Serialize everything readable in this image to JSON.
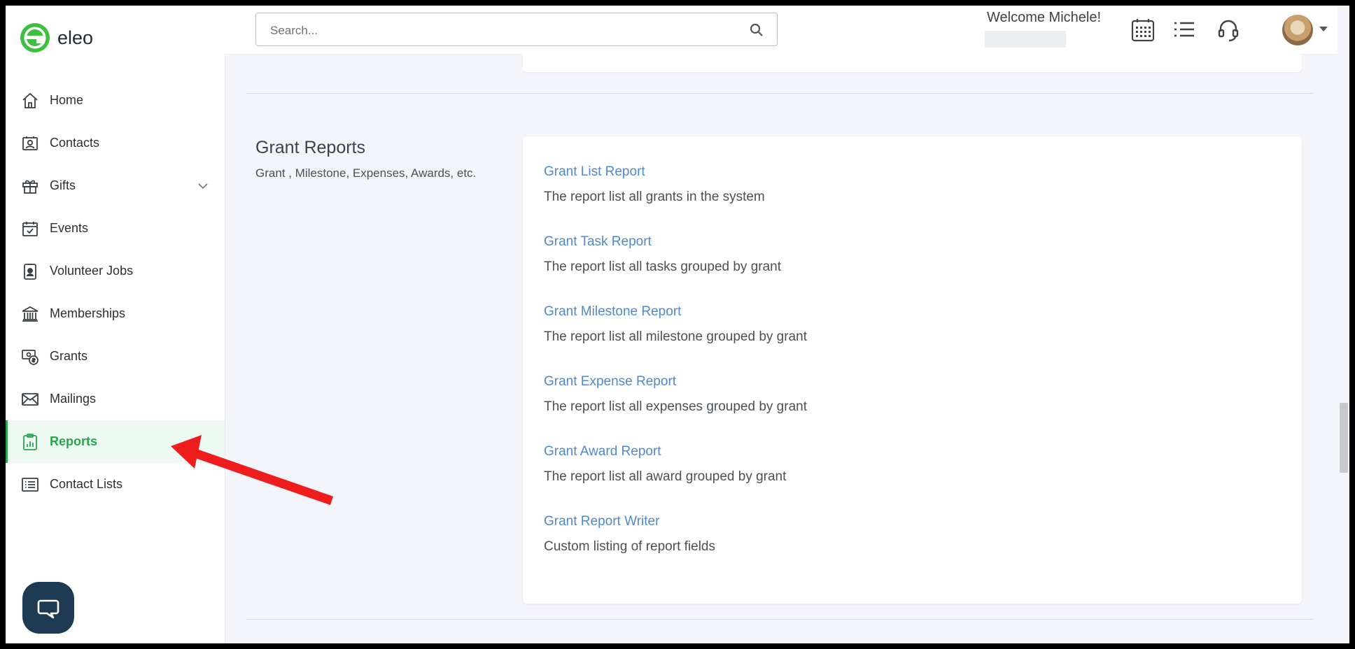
{
  "app": {
    "logo_text": "eleo",
    "brand_color": "#28a44e"
  },
  "sidebar": {
    "items": [
      {
        "label": "Home",
        "icon": "home-icon"
      },
      {
        "label": "Contacts",
        "icon": "contacts-icon"
      },
      {
        "label": "Gifts",
        "icon": "gift-icon",
        "expandable": true
      },
      {
        "label": "Events",
        "icon": "calendar-check-icon"
      },
      {
        "label": "Volunteer Jobs",
        "icon": "volunteer-badge-icon"
      },
      {
        "label": "Memberships",
        "icon": "institution-icon"
      },
      {
        "label": "Grants",
        "icon": "grant-money-icon"
      },
      {
        "label": "Mailings",
        "icon": "envelope-icon"
      },
      {
        "label": "Reports",
        "icon": "clipboard-chart-icon",
        "active": true
      },
      {
        "label": "Contact Lists",
        "icon": "list-icon"
      }
    ]
  },
  "header": {
    "search_placeholder": "Search...",
    "welcome": "Welcome Michele!"
  },
  "main": {
    "section": {
      "title": "Grant Reports",
      "subtitle": "Grant , Milestone, Expenses, Awards, etc.",
      "reports": [
        {
          "name": "Grant List Report",
          "description": "The report list all grants in the system"
        },
        {
          "name": "Grant Task Report",
          "description": "The report list all tasks grouped by grant"
        },
        {
          "name": "Grant Milestone Report",
          "description": "The report list all milestone grouped by grant"
        },
        {
          "name": "Grant Expense Report",
          "description": "The report list all expenses grouped by grant"
        },
        {
          "name": "Grant Award Report",
          "description": "The report list all award grouped by grant"
        },
        {
          "name": "Grant Report Writer",
          "description": "Custom listing of report fields"
        }
      ]
    }
  },
  "annotation": {
    "arrow_color": "#ee1c1c"
  }
}
